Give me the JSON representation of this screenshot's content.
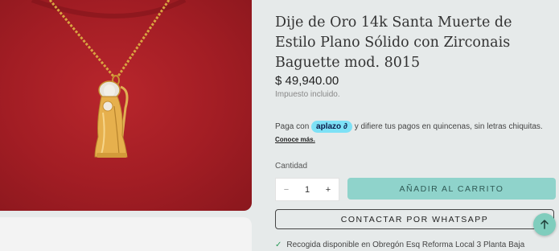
{
  "product": {
    "title": "Dije de Oro 14k Santa Muerte de Estilo Plano Sólido con Zirconais Baguette mod. 8015",
    "price": "$ 49,940.00",
    "tax_note": "Impuesto incluido."
  },
  "bnpl": {
    "prefix": "Paga con",
    "brand": "aplazo",
    "suffix": "y difiere tus pagos en quincenas, sin letras chiquitas.",
    "link": "Conoce más."
  },
  "quantity": {
    "label": "Cantidad",
    "value": "1",
    "minus": "−",
    "plus": "+"
  },
  "actions": {
    "add_to_cart": "AÑADIR AL CARRITO",
    "whatsapp": "CONTACTAR POR WHATSAPP"
  },
  "pickup": {
    "text": "Recogida disponible en Obregón Esq Reforma Local 3 Planta Baja"
  },
  "icons": {
    "scroll_top": "arrow-up-icon",
    "pickup": "check-icon"
  },
  "colors": {
    "background": "#e6eaea",
    "accent": "#8fd3cb",
    "aplazo": "#7de1f6",
    "shirt": "#a21d24",
    "gold": "#d9a441"
  }
}
